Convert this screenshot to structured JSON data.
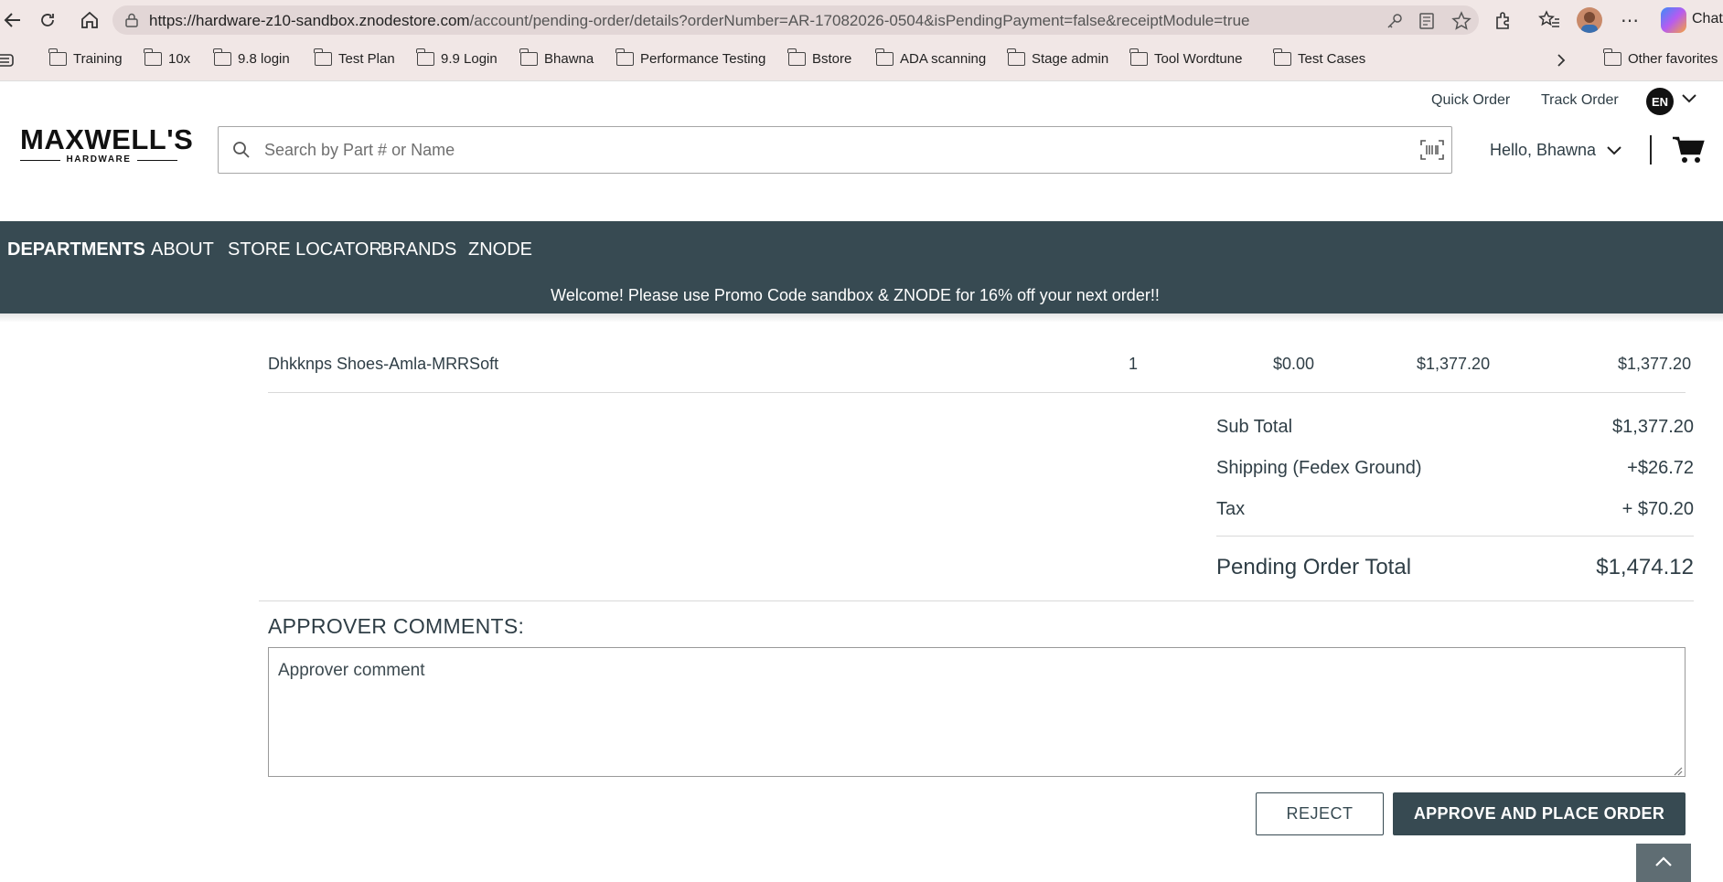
{
  "browser": {
    "url_host": "https://hardware-z10-sandbox.znodestore.com",
    "url_path": "/account/pending-order/details?orderNumber=AR-17082026-0504&isPendingPayment=false&receiptModule=true",
    "copilot_label": "Chat",
    "bookmarks": [
      "Training",
      "10x",
      "9.8 login",
      "Test Plan",
      "9.9 Login",
      "Bhawna",
      "Performance Testing",
      "Bstore",
      "ADA scanning",
      "Stage admin",
      "Tool Wordtune",
      "Test Cases"
    ],
    "other_favorites": "Other favorites"
  },
  "header": {
    "logo_main": "MAXWELL'S",
    "logo_sub": "HARDWARE",
    "search_placeholder": "Search by Part # or Name",
    "quick_order": "Quick Order",
    "track_order": "Track Order",
    "lang": "EN",
    "greeting": "Hello, Bhawna"
  },
  "nav": {
    "items": [
      "DEPARTMENTS",
      "ABOUT",
      "STORE LOCATOR",
      "BRANDS",
      "ZNODE"
    ],
    "promo": "Welcome! Please use Promo Code sandbox & ZNODE for 16% off your next order!!"
  },
  "order_item": {
    "name": "Dhkknps Shoes-Amla-MRRSoft",
    "quantity": "1",
    "discount": "$0.00",
    "price": "$1,377.20",
    "total": "$1,377.20"
  },
  "summary": {
    "subtotal_label": "Sub Total",
    "subtotal_value": "$1,377.20",
    "shipping_label": "Shipping (Fedex Ground)",
    "shipping_value": "+$26.72",
    "tax_label": "Tax",
    "tax_value": "+ $70.20",
    "total_label": "Pending Order Total",
    "total_value": "$1,474.12"
  },
  "approver": {
    "title": "APPROVER COMMENTS:",
    "comment": "Approver comment"
  },
  "actions": {
    "reject": "REJECT",
    "approve": "APPROVE AND PLACE ORDER"
  }
}
